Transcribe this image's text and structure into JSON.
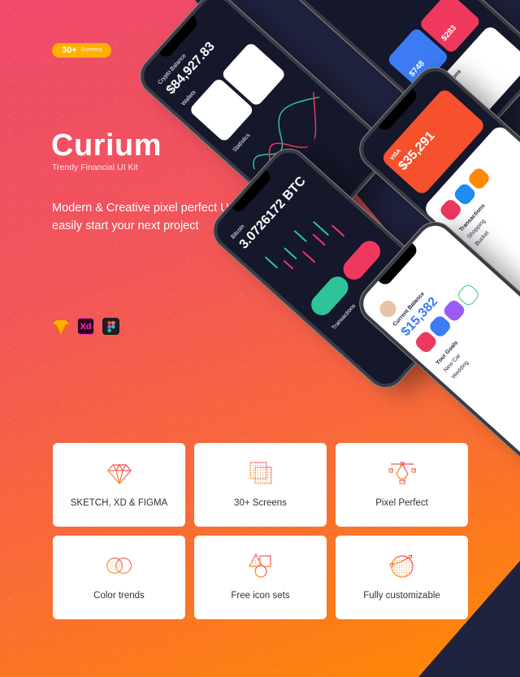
{
  "badge": {
    "count": "30+",
    "label": "Screens"
  },
  "hero": {
    "title": "Curium",
    "subtitle": "Trendy Financial UI Kit",
    "tagline": "Modern & Creative pixel perfect UI Kit to easily start your next project"
  },
  "tools": [
    {
      "icon": "sketch-icon",
      "color": "#fdb300"
    },
    {
      "icon": "xd-icon",
      "label": "Xd",
      "color": "#ff2bc2"
    },
    {
      "icon": "figma-icon",
      "color": "#1e1e1e"
    }
  ],
  "phones": {
    "crypto": {
      "label": "Crypto Balance",
      "amount": "$84,927.83",
      "section": "Wallets",
      "stats": "Statistics"
    },
    "expenses": {
      "card1": "$748",
      "card2": "$283",
      "list": "Transactions"
    },
    "cards": {
      "brand": "VISA",
      "amount": "$35,291",
      "list": "Transactions",
      "item1": "Shopping",
      "item2": "Bucket"
    },
    "trade": {
      "amount": "3.0726172 BTC",
      "title": "Bitcoin",
      "section": "Transactions"
    },
    "wallet": {
      "label": "Current Balance",
      "amount": "$15,382",
      "goals": "Your Goals",
      "goal1": "New Car",
      "goal2": "Wedding"
    }
  },
  "colors": {
    "navy": "#20233f",
    "orange": "#ff8a00",
    "pink": "#ef4a6a",
    "green": "#2fc39a",
    "red": "#f0385f",
    "blue": "#3d7bf5"
  },
  "features": [
    {
      "icon": "diamond-icon",
      "label": "SKETCH, XD & FIGMA"
    },
    {
      "icon": "screens-icon",
      "label": "30+ Screens"
    },
    {
      "icon": "pen-tool-icon",
      "label": "Pixel Perfect"
    },
    {
      "icon": "color-circles-icon",
      "label": "Color trends"
    },
    {
      "icon": "shapes-icon",
      "label": "Free icon sets"
    },
    {
      "icon": "customize-icon",
      "label": "Fully customizable"
    }
  ]
}
